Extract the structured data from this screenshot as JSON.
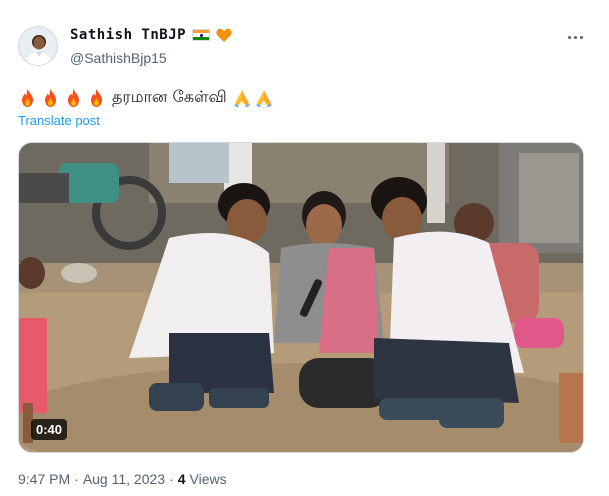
{
  "author": {
    "display_name": "Sathish TnBJP",
    "handle": "@SathishBjp15",
    "badges": [
      "india-flag-icon",
      "orange-heart-icon"
    ]
  },
  "tweet": {
    "emoji_prefix": [
      "fire-icon",
      "fire-icon",
      "fire-icon",
      "fire-icon"
    ],
    "text": "தரமான கேள்வி",
    "emoji_suffix": [
      "folded-hands-icon",
      "folded-hands-icon"
    ],
    "translate_label": "Translate post"
  },
  "media": {
    "type": "video",
    "duration": "0:40"
  },
  "meta": {
    "time": "9:47 PM",
    "separator1": "·",
    "date": "Aug 11, 2023",
    "separator2": "·",
    "views_count": "4",
    "views_label": "Views"
  },
  "colors": {
    "link": "#1d9bf0",
    "secondary_text": "#536471",
    "primary_text": "#0f1419"
  }
}
